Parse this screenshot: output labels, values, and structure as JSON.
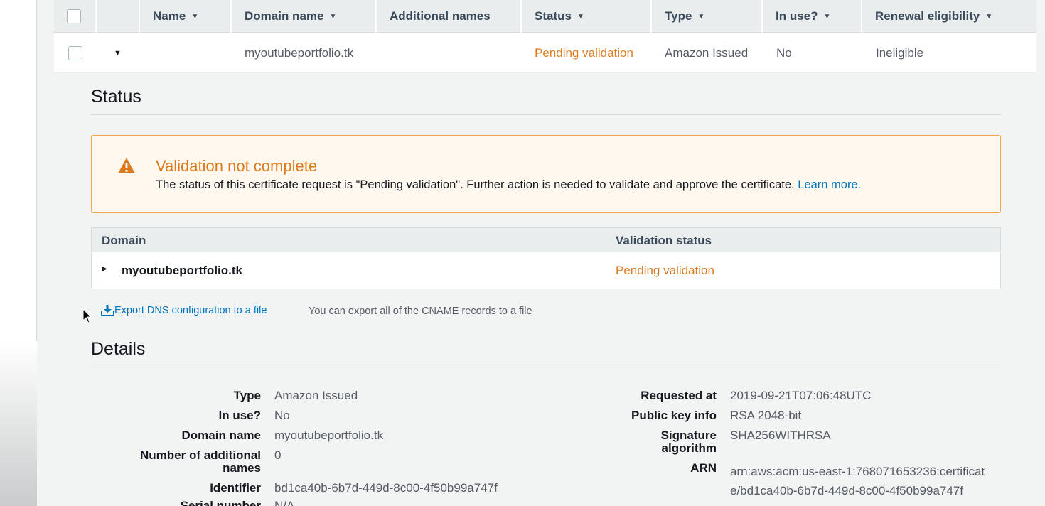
{
  "table": {
    "headers": {
      "name": "Name",
      "domain_name": "Domain name",
      "additional_names": "Additional names",
      "status": "Status",
      "type": "Type",
      "in_use": "In use?",
      "renewal": "Renewal eligibility"
    },
    "row": {
      "name": "",
      "domain_name": "myoutubeportfolio.tk",
      "additional_names": "",
      "status": "Pending validation",
      "type": "Amazon Issued",
      "in_use": "No",
      "renewal": "Ineligible"
    }
  },
  "status_section": {
    "title": "Status",
    "alert": {
      "title": "Validation not complete",
      "body": "The status of this certificate request is \"Pending validation\". Further action is needed to validate and approve the certificate.",
      "link": "Learn more."
    },
    "domain_table": {
      "col_domain": "Domain",
      "col_validation": "Validation status",
      "rows": [
        {
          "domain": "myoutubeportfolio.tk",
          "validation_status": "Pending validation"
        }
      ]
    },
    "export_link": "Export DNS configuration to a file",
    "export_note": "You can export all of the CNAME records to a file"
  },
  "details": {
    "title": "Details",
    "left": [
      {
        "label": "Type",
        "value": "Amazon Issued"
      },
      {
        "label": "In use?",
        "value": "No"
      },
      {
        "label": "Domain name",
        "value": "myoutubeportfolio.tk"
      },
      {
        "label": "Number of additional names",
        "value": "0"
      },
      {
        "label": "Identifier",
        "value": "bd1ca40b-6b7d-449d-8c00-4f50b99a747f"
      },
      {
        "label": "Serial number",
        "value": "N/A"
      }
    ],
    "right": [
      {
        "label": "Requested at",
        "value": "2019-09-21T07:06:48UTC"
      },
      {
        "label": "Public key info",
        "value": "RSA 2048-bit"
      },
      {
        "label": "Signature algorithm",
        "value": "SHA256WITHRSA"
      },
      {
        "label": "ARN",
        "value": "arn:aws:acm:us-east-1:768071653236:certificate/bd1ca40b-6b7d-449d-8c00-4f50b99a747f"
      }
    ]
  },
  "colors": {
    "warning": "#dd7a1e",
    "link": "#0073bb"
  }
}
